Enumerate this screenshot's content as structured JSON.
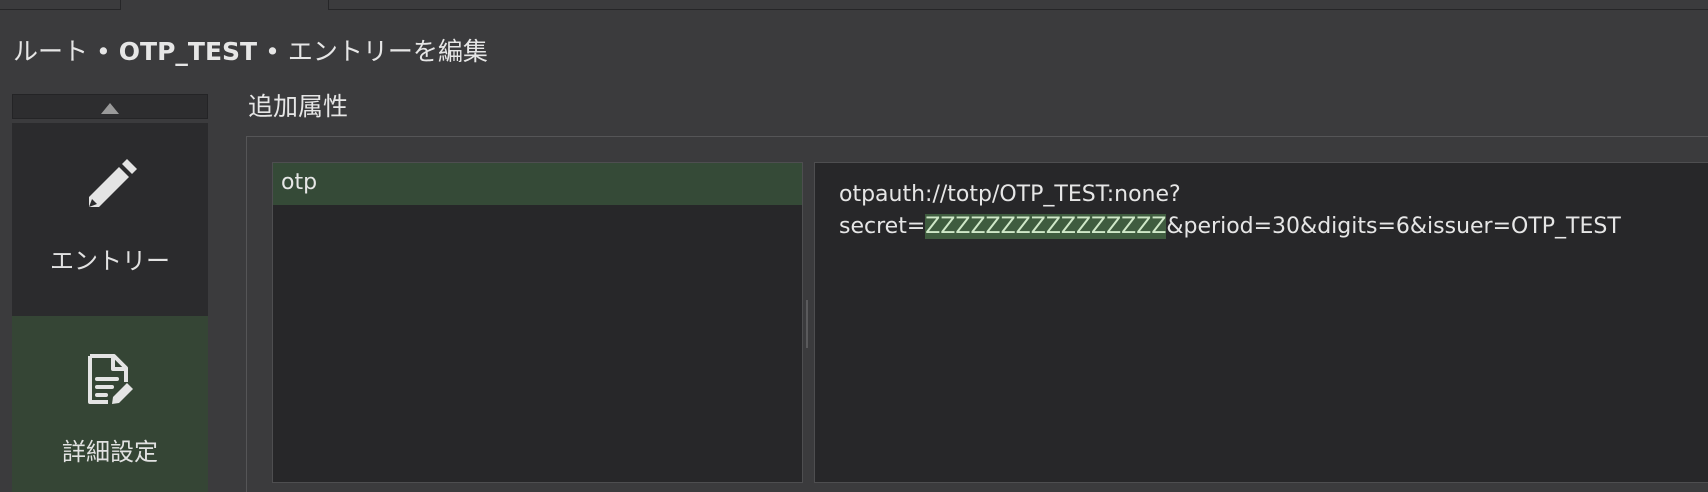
{
  "breadcrumb": {
    "root": "ルート",
    "separator": "•",
    "entry_name": "OTP_TEST",
    "action": "エントリーを編集"
  },
  "nav": {
    "scroll_up_icon": "triangle-up-icon",
    "items": [
      {
        "label": "エントリー",
        "icon": "pencil-icon",
        "selected": false
      },
      {
        "label": "詳細設定",
        "icon": "document-edit-icon",
        "selected": true
      }
    ]
  },
  "section": {
    "title": "追加属性"
  },
  "attributes": {
    "items": [
      {
        "name": "otp",
        "selected": true
      }
    ]
  },
  "value": {
    "line1": "otpauth://totp/OTP_TEST:none?",
    "line2_prefix": "secret=",
    "line2_highlight": "ZZZZZZZZZZZZZZZZ",
    "line2_suffix": "&period=30&digits=6&issuer=OTP_TEST"
  },
  "colors": {
    "background": "#3b3b3d",
    "panel": "#272729",
    "selection_green": "#354a37",
    "highlight_green": "#3f5c3f",
    "text": "#e6e6e6"
  }
}
